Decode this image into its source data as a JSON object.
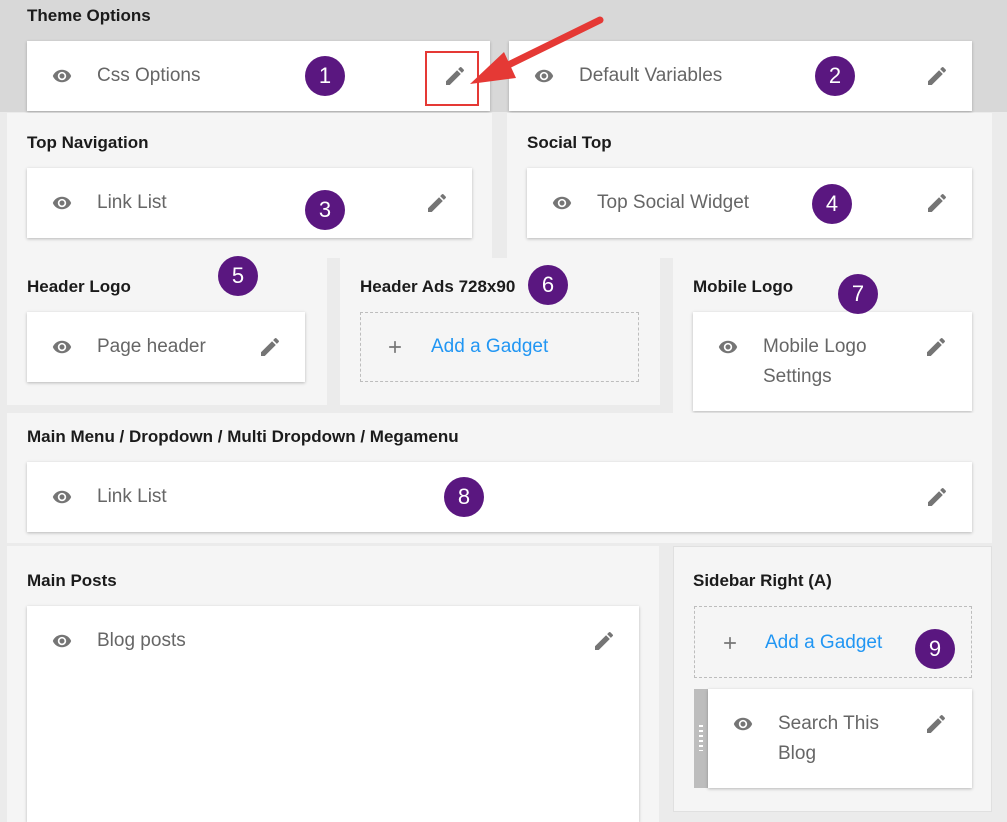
{
  "sections": {
    "theme_options": {
      "title": "Theme Options"
    },
    "top_navigation": {
      "title": "Top Navigation"
    },
    "social_top": {
      "title": "Social Top"
    },
    "header_logo": {
      "title": "Header Logo"
    },
    "header_ads": {
      "title": "Header Ads 728x90"
    },
    "mobile_logo": {
      "title": "Mobile Logo"
    },
    "main_menu": {
      "title": "Main Menu / Dropdown / Multi Dropdown / Megamenu"
    },
    "main_posts": {
      "title": "Main Posts"
    },
    "sidebar_right": {
      "title": "Sidebar Right (A)"
    }
  },
  "widgets": {
    "css_options": "Css Options",
    "default_variables": "Default Variables",
    "link_list_top": "Link List",
    "top_social_widget": "Top Social Widget",
    "page_header": "Page header",
    "mobile_logo_line1": "Mobile Logo",
    "mobile_logo_line2": "Settings",
    "link_list_menu": "Link List",
    "blog_posts": "Blog posts",
    "search_line1": "Search This",
    "search_line2": "Blog"
  },
  "add_gadget": "Add a Gadget",
  "badges": [
    "1",
    "2",
    "3",
    "4",
    "5",
    "6",
    "7",
    "8",
    "9"
  ],
  "colors": {
    "badge": "#5a1780",
    "link": "#2196f3",
    "annotation": "#e53935",
    "icon": "#757575"
  },
  "icons": [
    "eye-icon",
    "pencil-icon",
    "plus-icon",
    "red-arrow-annotation"
  ]
}
